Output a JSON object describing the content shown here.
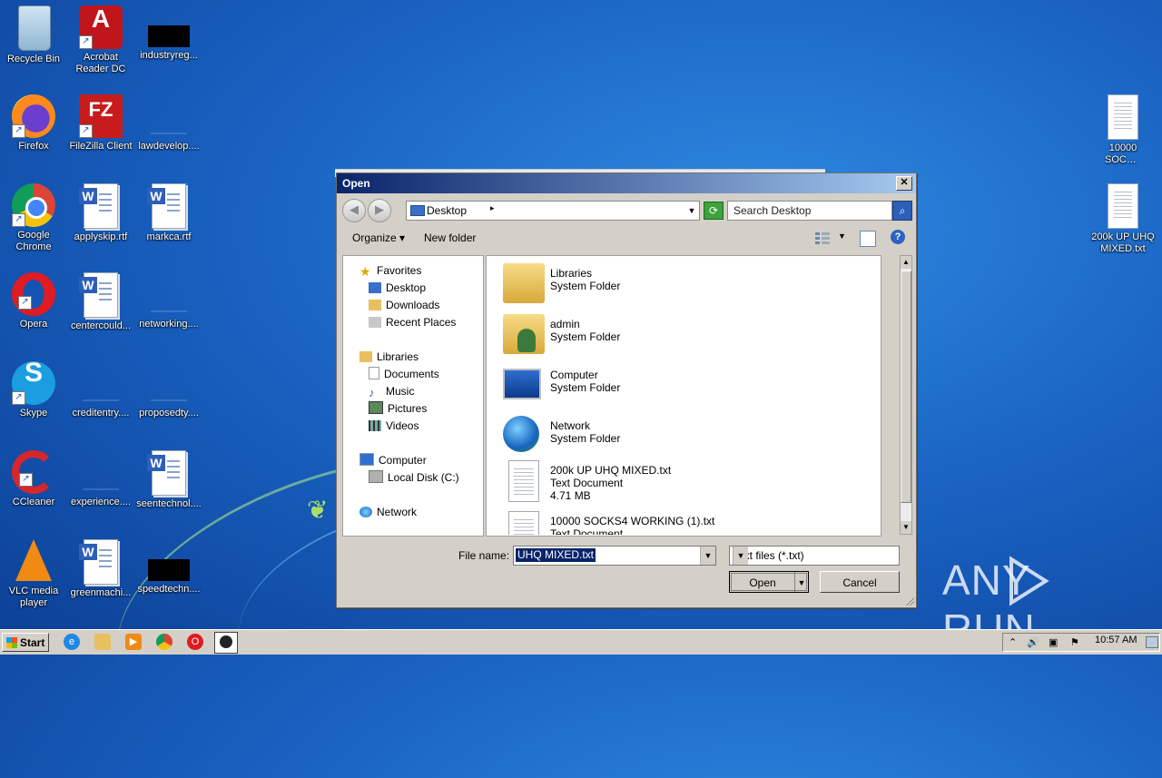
{
  "desktop": {
    "icons": [
      {
        "label": "Recycle Bin",
        "icon": "recycle-bin-icon"
      },
      {
        "label": "Acrobat Reader DC",
        "icon": "acrobat-icon"
      },
      {
        "label": "industryreg...",
        "icon": "black-file-icon"
      },
      {
        "label": "Firefox",
        "icon": "firefox-icon"
      },
      {
        "label": "FileZilla Client",
        "icon": "filezilla-icon"
      },
      {
        "label": "lawdevelop....",
        "icon": "file-icon"
      },
      {
        "label": "Google Chrome",
        "icon": "chrome-icon"
      },
      {
        "label": "applyskip.rtf",
        "icon": "word-doc-icon"
      },
      {
        "label": "markca.rtf",
        "icon": "word-doc-icon"
      },
      {
        "label": "Opera",
        "icon": "opera-icon"
      },
      {
        "label": "centercould...",
        "icon": "word-doc-icon"
      },
      {
        "label": "networking....",
        "icon": "file-icon"
      },
      {
        "label": "Skype",
        "icon": "skype-icon"
      },
      {
        "label": "creditentry....",
        "icon": "file-icon"
      },
      {
        "label": "proposedty....",
        "icon": "file-icon"
      },
      {
        "label": "CCleaner",
        "icon": "ccleaner-icon"
      },
      {
        "label": "experience....",
        "icon": "file-icon"
      },
      {
        "label": "seentechnol....",
        "icon": "word-doc-icon"
      },
      {
        "label": "VLC media player",
        "icon": "vlc-icon"
      },
      {
        "label": "greenmachi...",
        "icon": "word-doc-icon"
      },
      {
        "label": "speedtechn....",
        "icon": "black-file-icon"
      },
      {
        "label": "10000 SOCKS...",
        "icon": "text-file-icon"
      },
      {
        "label": "200k UP UHQ MIXED.txt",
        "icon": "text-file-icon"
      }
    ]
  },
  "dialog": {
    "title": "Open",
    "close": "✕",
    "address": {
      "location": "Desktop",
      "chevron": "▸"
    },
    "search_placeholder": "Search Desktop",
    "toolbar": {
      "organize": "Organize",
      "new_folder": "New folder"
    },
    "nav": {
      "favorites": "Favorites",
      "desktop": "Desktop",
      "downloads": "Downloads",
      "recent_places": "Recent Places",
      "libraries": "Libraries",
      "documents": "Documents",
      "music": "Music",
      "pictures": "Pictures",
      "videos": "Videos",
      "computer": "Computer",
      "local_disk": "Local Disk (C:)",
      "network": "Network"
    },
    "items": [
      {
        "name": "Libraries",
        "type": "System Folder",
        "size": "",
        "icon": "libraries-folder-icon"
      },
      {
        "name": "admin",
        "type": "System Folder",
        "size": "",
        "icon": "user-folder-icon"
      },
      {
        "name": "Computer",
        "type": "System Folder",
        "size": "",
        "icon": "computer-icon"
      },
      {
        "name": "Network",
        "type": "System Folder",
        "size": "",
        "icon": "network-globe-icon"
      },
      {
        "name": "200k UP UHQ MIXED.txt",
        "type": "Text Document",
        "size": "4.71 MB",
        "icon": "text-document-icon"
      },
      {
        "name": "10000 SOCKS4 WORKING (1).txt",
        "type": "Text Document",
        "size": "",
        "icon": "text-document-icon"
      }
    ],
    "file_name_label": "File name:",
    "file_name_value": "UHQ MIXED.txt",
    "file_type": "Text files (*.txt)",
    "open_button": "Open",
    "cancel_button": "Cancel"
  },
  "taskbar": {
    "start": "Start",
    "clock": "10:57 AM"
  },
  "watermark": {
    "text_left": "ANY",
    "text_right": "RUN"
  }
}
